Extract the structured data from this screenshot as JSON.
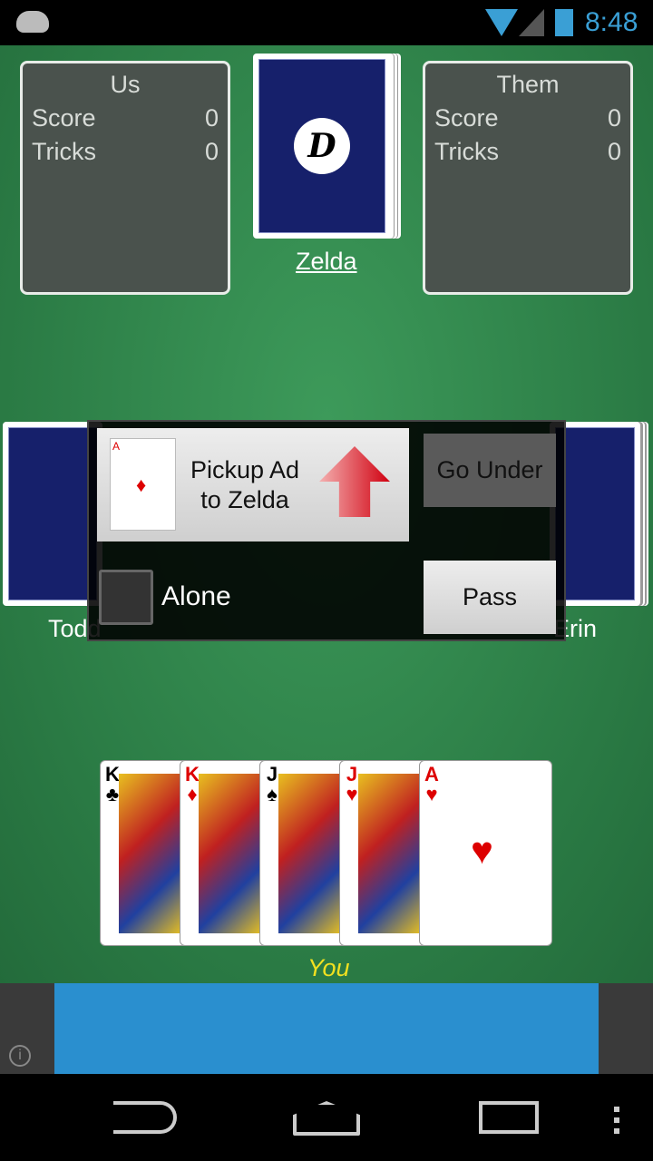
{
  "status": {
    "time": "8:48",
    "icons": [
      "android-icon",
      "wifi-icon",
      "signal-icon",
      "battery-charging-icon"
    ]
  },
  "us": {
    "title": "Us",
    "score_label": "Score",
    "score": "0",
    "tricks_label": "Tricks",
    "tricks": "0"
  },
  "them": {
    "title": "Them",
    "score_label": "Score",
    "score": "0",
    "tricks_label": "Tricks",
    "tricks": "0"
  },
  "players": {
    "top": "Zelda",
    "left": "Todd",
    "right": "Erin",
    "bottom": "You"
  },
  "deck_logo": "D",
  "dialog": {
    "pickup_line1": "Pickup Ad",
    "pickup_line2": "to Zelda",
    "upcard_rank": "A",
    "upcard_suit": "♦",
    "go_under": "Go Under",
    "alone": "Alone",
    "pass": "Pass"
  },
  "hand": [
    {
      "rank": "K",
      "suit": "♣",
      "color": "black"
    },
    {
      "rank": "K",
      "suit": "♦",
      "color": "red"
    },
    {
      "rank": "J",
      "suit": "♠",
      "color": "black"
    },
    {
      "rank": "J",
      "suit": "♥",
      "color": "red"
    },
    {
      "rank": "A",
      "suit": "♥",
      "color": "red"
    }
  ],
  "colors": {
    "felt": "#2f8a4c",
    "card_back": "#16206b",
    "ad": "#2a8fcf",
    "you": "#f0e020"
  }
}
